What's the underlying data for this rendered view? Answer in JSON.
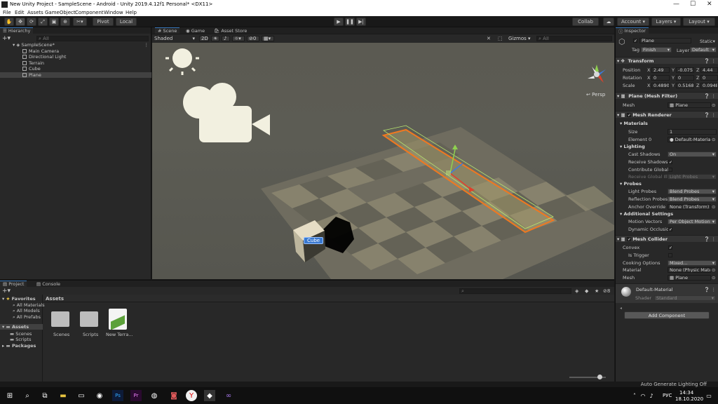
{
  "window": {
    "title": "New Unity Project - SampleScene - Android - Unity 2019.4.12f1 Personal* <DX11>"
  },
  "menu": [
    "File",
    "Edit",
    "Assets",
    "GameObject",
    "Component",
    "Window",
    "Help"
  ],
  "toolbar": {
    "pivot": "Pivot",
    "local": "Local",
    "collab": "Collab",
    "account": "Account",
    "layers": "Layers",
    "layout": "Layout"
  },
  "hierarchy": {
    "tab": "Hierarchy",
    "search_placeholder": "All",
    "scene": "SampleScene*",
    "items": [
      "Main Camera",
      "Directional Light",
      "Terrain",
      "Cube",
      "Plane"
    ],
    "selected": "Plane"
  },
  "scene": {
    "tabs": [
      "Scene",
      "Game",
      "Asset Store"
    ],
    "shading": "Shaded",
    "mode_2d": "2D",
    "fx_count": "0",
    "gizmos": "Gizmos",
    "search_placeholder": "All",
    "persp": "Persp",
    "cube_label": "Cube"
  },
  "inspector": {
    "tab": "Inspector",
    "object_name": "Plane",
    "static": "Static",
    "tag_label": "Tag",
    "tag": "Finish",
    "layer_label": "Layer",
    "layer": "Default",
    "transform": {
      "title": "Transform",
      "position_label": "Position",
      "position": {
        "x": "2.49",
        "y": "-0.075",
        "z": "4.44"
      },
      "rotation_label": "Rotation",
      "rotation": {
        "x": "0",
        "y": "0",
        "z": "0"
      },
      "scale_label": "Scale",
      "scale": {
        "x": "0.4890",
        "y": "0.51686",
        "z": "0.0948"
      }
    },
    "mesh_filter": {
      "title": "Plane (Mesh Filter)",
      "mesh_label": "Mesh",
      "mesh": "Plane"
    },
    "mesh_renderer": {
      "title": "Mesh Renderer",
      "materials": "Materials",
      "size_label": "Size",
      "size": "1",
      "element_label": "Element 0",
      "element": "Default-Material",
      "lighting": "Lighting",
      "cast_label": "Cast Shadows",
      "cast": "On",
      "receive_label": "Receive Shadows",
      "contribute_label": "Contribute Global I",
      "receive_gi_label": "Receive Global Ill",
      "receive_gi": "Light Probes",
      "probes": "Probes",
      "light_probes_label": "Light Probes",
      "light_probes": "Blend Probes",
      "reflection_label": "Reflection Probes",
      "reflection": "Blend Probes",
      "anchor_label": "Anchor Override",
      "anchor": "None (Transform)",
      "additional": "Additional Settings",
      "motion_label": "Motion Vectors",
      "motion": "Per Object Motion",
      "dynamic_label": "Dynamic Occlusio"
    },
    "mesh_collider": {
      "title": "Mesh Collider",
      "convex_label": "Convex",
      "trigger_label": "Is Trigger",
      "cooking_label": "Cooking Options",
      "cooking": "Mixed...",
      "material_label": "Material",
      "material": "None (Physic Mater",
      "mesh_label": "Mesh",
      "mesh": "Plane"
    },
    "material": {
      "name": "Default-Material",
      "shader_label": "Shader",
      "shader": "Standard"
    },
    "add_component": "Add Component"
  },
  "project": {
    "tabs": [
      "Project",
      "Console"
    ],
    "favorites": "Favorites",
    "fav_items": [
      "All Materials",
      "All Models",
      "All Prefabs"
    ],
    "assets_label": "Assets",
    "asset_items": [
      "Scenes",
      "Scripts"
    ],
    "packages": "Packages",
    "breadcrumb": "Assets",
    "files": [
      "Scenes",
      "Scripts",
      "New Terra..."
    ],
    "count": "8"
  },
  "statusbar": {
    "text": "Auto Generate Lighting Off"
  },
  "taskbar": {
    "lang": "РУС",
    "time": "14:34",
    "date": "18.10.2020"
  },
  "colors": {
    "accent": "#3a79bb",
    "selection_orange": "#f07820",
    "bounds_green": "#b8e870"
  }
}
